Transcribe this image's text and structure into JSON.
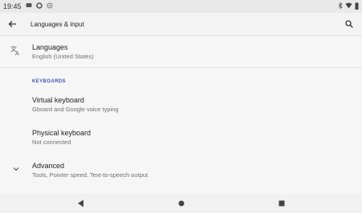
{
  "status_bar": {
    "time": "19:45",
    "left_icons": [
      "message-icon",
      "gear-icon",
      "at-icon"
    ],
    "right_icons": [
      "bluetooth-icon",
      "wifi-icon",
      "battery-icon"
    ]
  },
  "toolbar": {
    "title": "Languages & input"
  },
  "list": {
    "languages": {
      "title": "Languages",
      "subtitle": "English (United States)"
    },
    "keyboards_header": "KEYBOARDS",
    "virtual_keyboard": {
      "title": "Virtual keyboard",
      "subtitle": "Gboard and Google voice typing"
    },
    "physical_keyboard": {
      "title": "Physical keyboard",
      "subtitle": "Not connected"
    },
    "advanced": {
      "title": "Advanced",
      "subtitle": "Tools, Pointer speed, Text-to-speech output"
    }
  },
  "nav": {
    "buttons": [
      "back-icon",
      "home-icon",
      "recents-icon"
    ]
  },
  "colors": {
    "accent": "#3f51b5",
    "background": "#f6f6f6",
    "status_bar": "#e9e9e9"
  }
}
